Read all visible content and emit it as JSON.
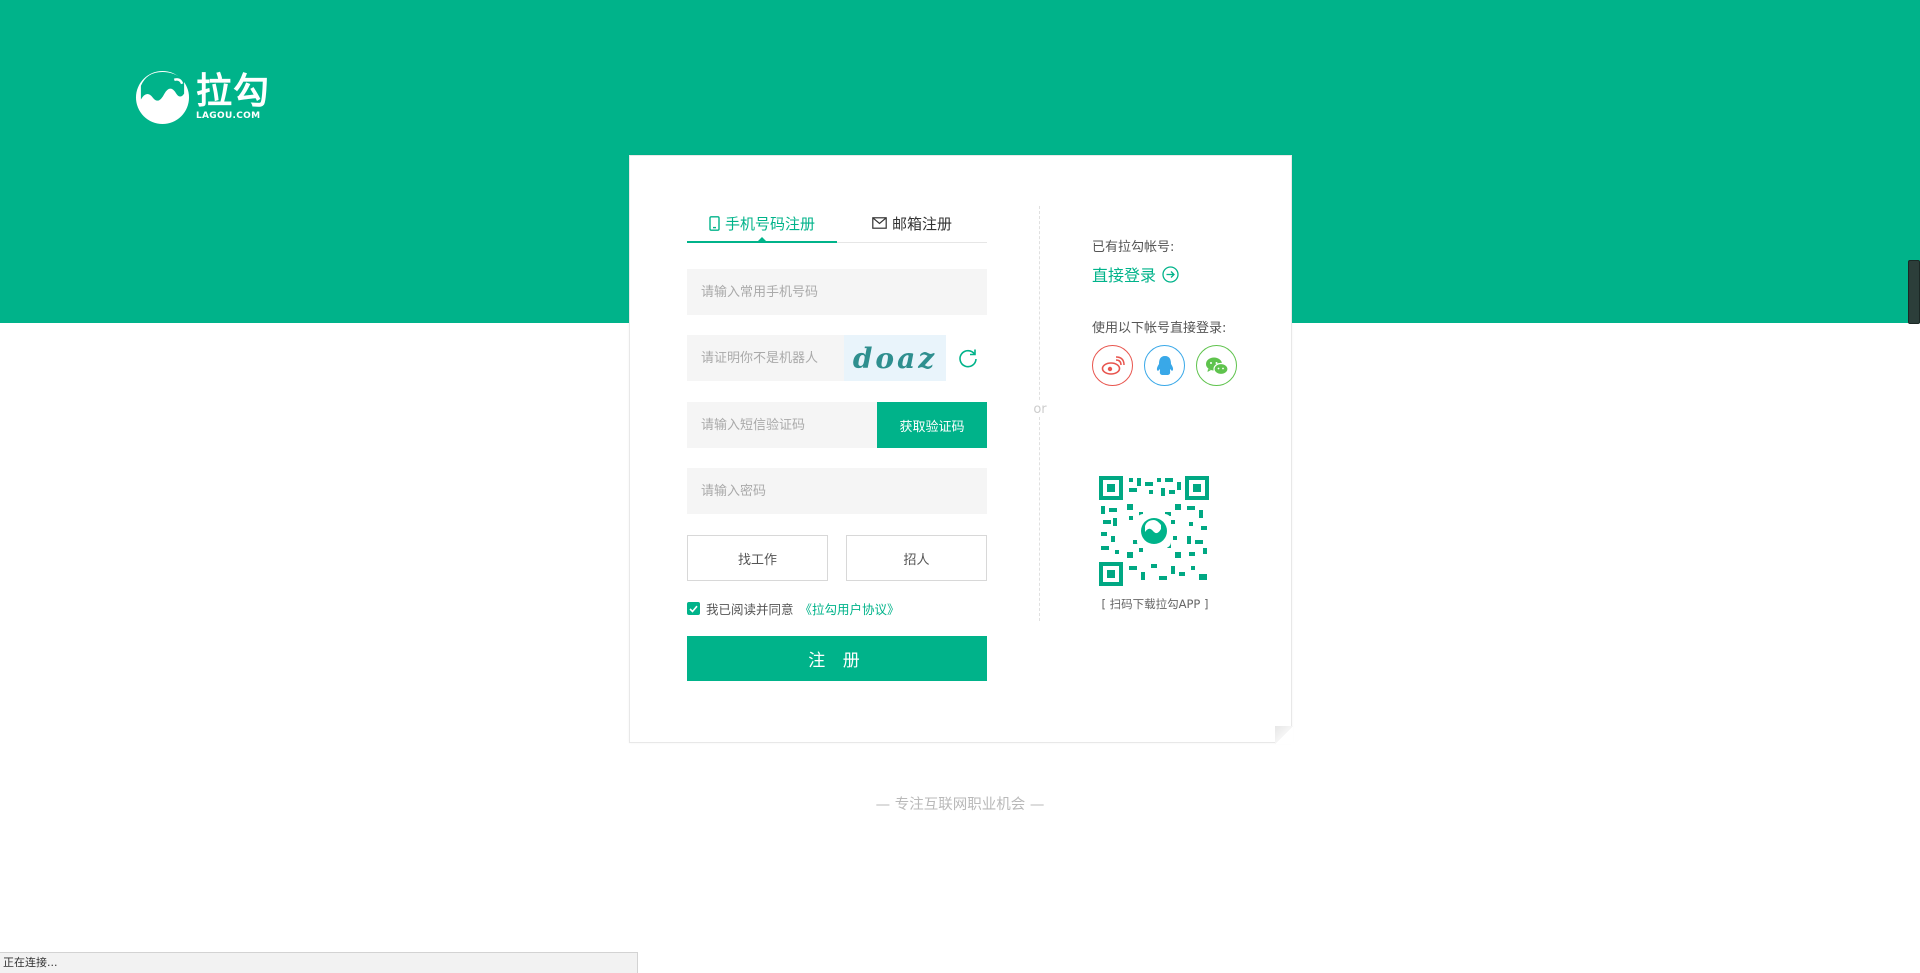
{
  "brand": {
    "name_cn": "拉勾",
    "name_en": "LAGOU.COM",
    "color": "#00b38a"
  },
  "tabs": [
    {
      "label": "手机号码注册",
      "icon": "phone-icon",
      "active": true
    },
    {
      "label": "邮箱注册",
      "icon": "mail-icon",
      "active": false
    }
  ],
  "form": {
    "phone_placeholder": "请输入常用手机号码",
    "captcha_placeholder": "请证明你不是机器人",
    "captcha_text": "doaz",
    "sms_placeholder": "请输入短信验证码",
    "sms_button": "获取验证码",
    "password_placeholder": "请输入密码",
    "roles": [
      "找工作",
      "招人"
    ],
    "agree_text": "我已阅读并同意",
    "agree_link": "《拉勾用户协议》",
    "agree_checked": true,
    "submit": "注 册"
  },
  "divider_text": "or",
  "side": {
    "has_account": "已有拉勾帐号:",
    "login_link": "直接登录",
    "third_party_label": "使用以下帐号直接登录:",
    "social": [
      {
        "name": "weibo-icon",
        "color": "#e8554e"
      },
      {
        "name": "qq-icon",
        "color": "#39a8e8"
      },
      {
        "name": "wechat-icon",
        "color": "#5fc34d"
      }
    ],
    "qr_caption": "[ 扫码下载拉勾APP ]"
  },
  "footer": {
    "slogan": "— 专注互联网职业机会 —"
  },
  "status_bar": {
    "text": "正在连接..."
  }
}
